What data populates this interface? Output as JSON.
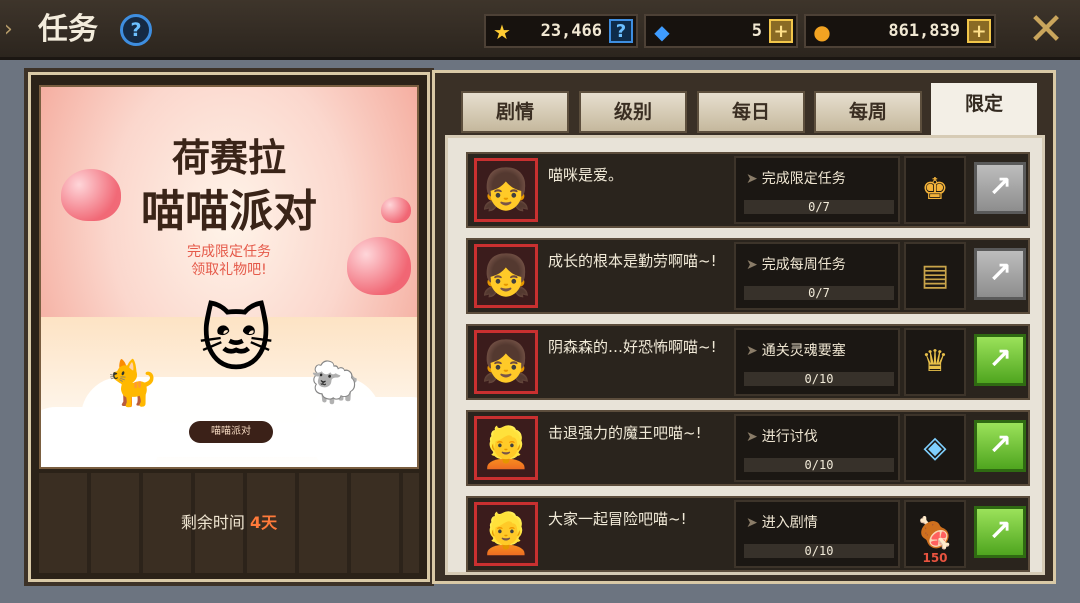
{
  "header": {
    "title": "任务",
    "help_label": "?",
    "currencies": [
      {
        "icon": "star-medal-icon",
        "value": "23,466",
        "action": "?"
      },
      {
        "icon": "blue-gem-icon",
        "value": "5",
        "action": "+"
      },
      {
        "icon": "gold-coin-icon",
        "value": "861,839",
        "action": "+"
      }
    ],
    "close_label": "✕"
  },
  "event": {
    "title_line1": "荷赛拉",
    "title_line2": "喵喵派对",
    "subtitle_line1": "完成限定任务",
    "subtitle_line2": "领取礼物吧!",
    "badge": "喵喵派对",
    "time_label": "剩余时间",
    "time_value": "4天"
  },
  "tabs": [
    {
      "label": "剧情",
      "active": false
    },
    {
      "label": "级别",
      "active": false
    },
    {
      "label": "每日",
      "active": false
    },
    {
      "label": "每周",
      "active": false
    },
    {
      "label": "限定",
      "active": true
    }
  ],
  "quests": [
    {
      "avatar": "pink-hair-girl-avatar",
      "desc": "喵咪是爱。",
      "task": "完成限定任务",
      "progress": "0/7",
      "progress_fraction": 0,
      "reward_icon": "gold-trophy-icon",
      "reward_extra": "",
      "button": "grey"
    },
    {
      "avatar": "green-hair-girl-avatar",
      "desc": "成长的根本是勤劳啊喵~!",
      "task": "完成每周任务",
      "progress": "0/7",
      "progress_fraction": 0,
      "reward_icon": "tome-icon",
      "reward_extra": "",
      "button": "grey"
    },
    {
      "avatar": "green-hair-girl-avatar",
      "desc": "阴森森的…好恐怖啊喵~!",
      "task": "通关灵魂要塞",
      "progress": "0/10",
      "progress_fraction": 0,
      "reward_icon": "treasure-crown-icon",
      "reward_extra": "",
      "button": "green"
    },
    {
      "avatar": "blonde-girl-avatar",
      "desc": "击退强力的魔王吧喵~!",
      "task": "进行讨伐",
      "progress": "0/10",
      "progress_fraction": 0,
      "reward_icon": "gem-amulet-icon",
      "reward_extra": "",
      "button": "green"
    },
    {
      "avatar": "blonde-girl-avatar",
      "desc": "大家一起冒险吧喵~!",
      "task": "进入剧情",
      "progress": "0/10",
      "progress_fraction": 0,
      "reward_icon": "meat-icon",
      "reward_extra": "150",
      "button": "green"
    }
  ]
}
